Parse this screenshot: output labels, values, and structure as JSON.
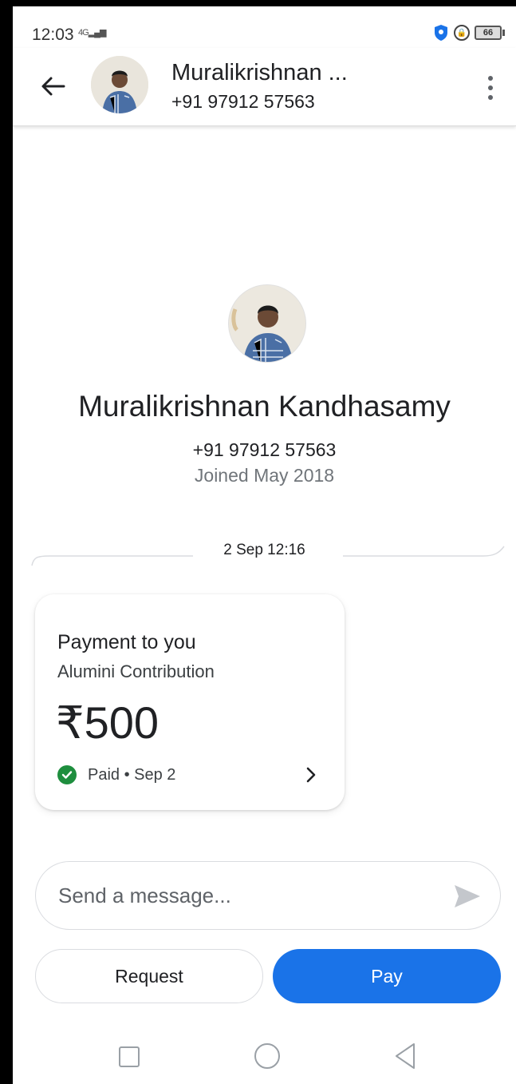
{
  "status_bar": {
    "time": "12:03",
    "network": "4G",
    "battery": "66"
  },
  "header": {
    "name": "Muralikrishnan ...",
    "phone": "+91 97912 57563"
  },
  "profile": {
    "full_name": "Muralikrishnan Kandhasamy",
    "phone": "+91 97912 57563",
    "joined": "Joined May 2018"
  },
  "conversation": {
    "date_divider": "2 Sep 12:16",
    "payment": {
      "title": "Payment to you",
      "note": "Alumini Contribution",
      "amount": "₹500",
      "status": "Paid • Sep 2"
    }
  },
  "composer": {
    "placeholder": "Send a message..."
  },
  "actions": {
    "request_label": "Request",
    "pay_label": "Pay"
  },
  "colors": {
    "primary": "#1a73e8",
    "success": "#1e8e3e",
    "shield": "#1a73e8"
  }
}
